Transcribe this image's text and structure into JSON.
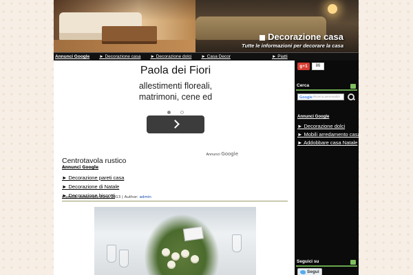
{
  "header": {
    "site_title": "Decorazione casa",
    "site_description": "Tutte le informazioni per decorare la casa"
  },
  "topnav": {
    "ad_label": "Annunci Google",
    "items": [
      "Decorazione casa",
      "Decorazione dolci",
      "Casa Decor",
      "Piatti"
    ]
  },
  "ad": {
    "title": "Paola dei Fiori",
    "subtitle_line1": "allestimenti floreali,",
    "subtitle_line2": "matrimoni, cene ed",
    "adsense_label": "Annunci",
    "adsense_brand": "Google"
  },
  "post": {
    "title": "Centrotavola rustico",
    "ad_label": "Annunci Google",
    "links": [
      "Decorazione pareti casa",
      "Decorazione di Natale",
      "Decorazione biscotti"
    ],
    "meta_date": "martedì, settembre 03rd, 2013 | Author:",
    "meta_author": "admin"
  },
  "sidebar": {
    "gplus_label": "g+1",
    "gplus_count": "86",
    "search_heading": "Cerca",
    "search_logo": "Google",
    "search_placeholder": "Ricerca personalizz",
    "ad_label": "Annunci Google",
    "links": [
      "Decorazione dolci",
      "Mobili arredamento casa",
      "Addobbare casa Natale"
    ],
    "follow_heading": "Seguici su",
    "follow_label": "Segui"
  },
  "colors": {
    "accent_green": "#6aa84f",
    "gplus_red": "#d73d32",
    "sidebar_bg": "#0b0b0b"
  }
}
